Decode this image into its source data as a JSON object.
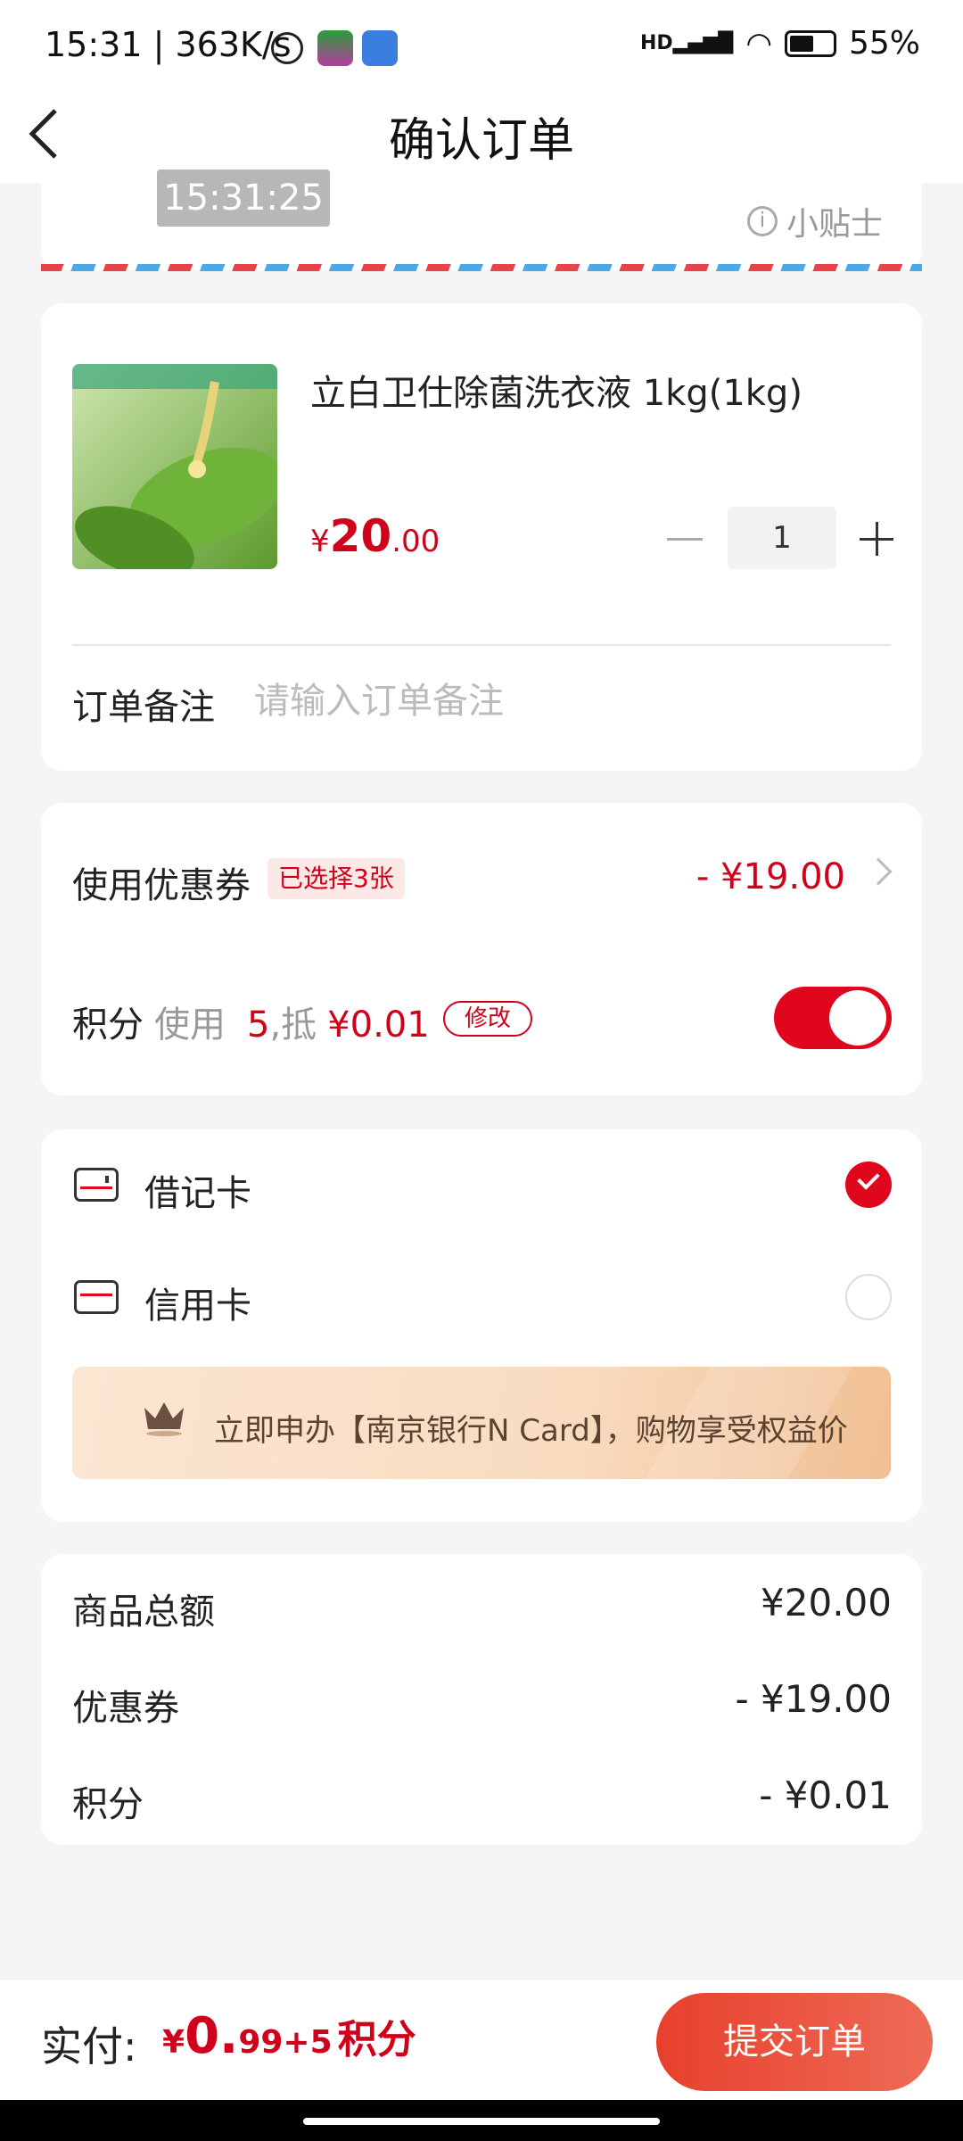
{
  "status_bar": {
    "time": "15:31 | 363K/s",
    "battery": "55%"
  },
  "header": {
    "title": "确认订单"
  },
  "overlay_time": "15:31:25",
  "tip_label": "小贴士",
  "product": {
    "name": "立白卫仕除菌洗衣液 1kg(1kg)",
    "price_currency": "¥",
    "price_int": "20",
    "price_dec": ".00",
    "quantity": "1"
  },
  "remark": {
    "label": "订单备注",
    "placeholder": "请输入订单备注"
  },
  "coupon": {
    "label": "使用优惠券",
    "badge": "已选择3张",
    "amount": "- ¥19.00"
  },
  "points": {
    "label": "积分",
    "use_text": "使用",
    "count": "5",
    "offset_text": ",抵",
    "offset_amount": "¥0.01",
    "modify_label": "修改",
    "enabled": true
  },
  "payment": {
    "debit_label": "借记卡",
    "credit_label": "信用卡",
    "selected": "debit",
    "banner_text": "立即申办【南京银行N Card】，购物享受权益价"
  },
  "summary": {
    "rows": [
      {
        "label": "商品总额",
        "value": "¥20.00"
      },
      {
        "label": "优惠券",
        "value": "- ¥19.00"
      },
      {
        "label": "积分",
        "value": "- ¥0.01"
      }
    ]
  },
  "bottom": {
    "actual_label": "实付:",
    "cur": "¥",
    "amount_int": "0.",
    "amount_dec": "99",
    "plus_points": "+5",
    "points_unit": "积分",
    "submit_label": "提交订单"
  },
  "colors": {
    "accent": "#d0021b",
    "toggle": "#e0071d",
    "submit_start": "#e7402c",
    "submit_end": "#ee6b57"
  }
}
